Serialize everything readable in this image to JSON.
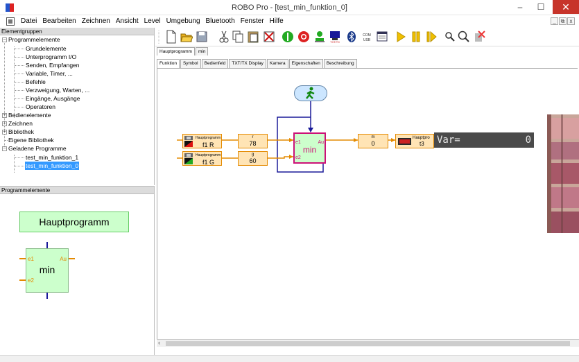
{
  "window": {
    "title": "ROBO Pro - [test_min_funktion_0]",
    "minimize": "–",
    "maximize": "☐",
    "close": "✕"
  },
  "menu": [
    "Datei",
    "Bearbeiten",
    "Zeichnen",
    "Ansicht",
    "Level",
    "Umgebung",
    "Bluetooth",
    "Fenster",
    "Hilfe"
  ],
  "mdi_buttons": [
    "_",
    "⧉",
    "x"
  ],
  "left_top": {
    "header": "Elementgruppen",
    "tree": [
      {
        "label": "Programmelemente",
        "toggle": "−"
      },
      {
        "label": "Grundelemente"
      },
      {
        "label": "Unterprogramm I/O"
      },
      {
        "label": "Senden, Empfangen"
      },
      {
        "label": "Variable, Timer, ..."
      },
      {
        "label": "Befehle"
      },
      {
        "label": "Verzweigung, Warten, ..."
      },
      {
        "label": "Eingänge, Ausgänge"
      },
      {
        "label": "Operatoren"
      },
      {
        "label": "Bedienelemente",
        "toggle": "+"
      },
      {
        "label": "Zeichnen",
        "toggle": "+"
      },
      {
        "label": "Bibliothek",
        "toggle": "+"
      },
      {
        "label": "Eigene Bibliothek"
      },
      {
        "label": "Geladene Programme",
        "toggle": "−"
      },
      {
        "label": "test_min_funktion_1"
      },
      {
        "label": "test_min_funktion_0",
        "selected": true
      }
    ]
  },
  "left_bottom": {
    "header": "Programmelemente",
    "main_block": "Hauptprogramm",
    "min_block": {
      "name": "min",
      "in1": "e1",
      "in2": "e2",
      "out": "Au"
    }
  },
  "program_tabs": [
    "Hauptprogramm",
    "min"
  ],
  "view_tabs": [
    "Funktion",
    "Symbol",
    "Bedienfeld",
    "TXT/TX Display",
    "Kamera",
    "Eigenschaften",
    "Beschreibung"
  ],
  "diagram": {
    "input1": {
      "top": "Hauptprogramm",
      "label": "f1 R"
    },
    "input2": {
      "top": "Hauptprogramm",
      "label": "f1 G"
    },
    "var_r": {
      "name": "r",
      "value": "78"
    },
    "var_g": {
      "name": "g",
      "value": "60"
    },
    "min_block": {
      "name": "min",
      "in1": "e1",
      "in2": "e2",
      "out": "Au"
    },
    "var_m": {
      "name": "m",
      "value": "0"
    },
    "display_block": {
      "top": "Hauptpro",
      "label": "t3"
    },
    "lcd": {
      "text": "Var=",
      "value": "0"
    }
  },
  "colors": {
    "accent_orange": "#e48a00",
    "min_magenta": "#cc1177",
    "wire_blue": "#1a1a99",
    "selection": "#3399ff"
  }
}
